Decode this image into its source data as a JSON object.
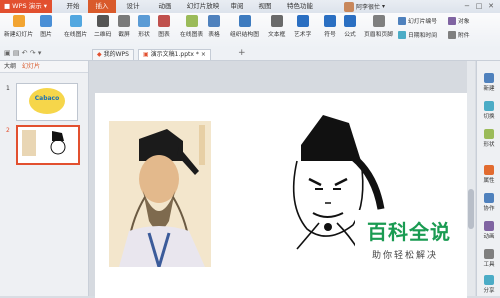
{
  "app": {
    "name": "WPS 演示",
    "user": "阿李很忙",
    "login_hint": ""
  },
  "menu": [
    "开始",
    "插入",
    "设计",
    "动画",
    "幻灯片放映",
    "审阅",
    "视图",
    "特色功能"
  ],
  "active_menu": "插入",
  "ribbon": {
    "big": [
      "新建幻灯片",
      "图片",
      "在线图片",
      "二维码",
      "截屏",
      "形状",
      "图表",
      "在线图表",
      "表格",
      "组织结构图",
      "文本框",
      "艺术字",
      "符号",
      "公式",
      "页眉和页脚",
      "附件"
    ],
    "small": [
      "幻灯片编号",
      "对象",
      "日期和时间"
    ]
  },
  "doc_tabs": [
    {
      "label": "我的WPS"
    },
    {
      "label": "演示文稿1.pptx *"
    }
  ],
  "left_pane": {
    "tabs": [
      "大纲",
      "幻灯片"
    ],
    "active_tab": "幻灯片",
    "slides": [
      "1",
      "2"
    ]
  },
  "right_bar": [
    "新建",
    "切换",
    "形状",
    "属性",
    "协作",
    "动画",
    "工具",
    "分享"
  ],
  "slide2": {
    "caption": ""
  },
  "watermark": {
    "main": "百科全说",
    "sub": "助你轻松解决"
  },
  "thumb1_logo": "Cabaco"
}
